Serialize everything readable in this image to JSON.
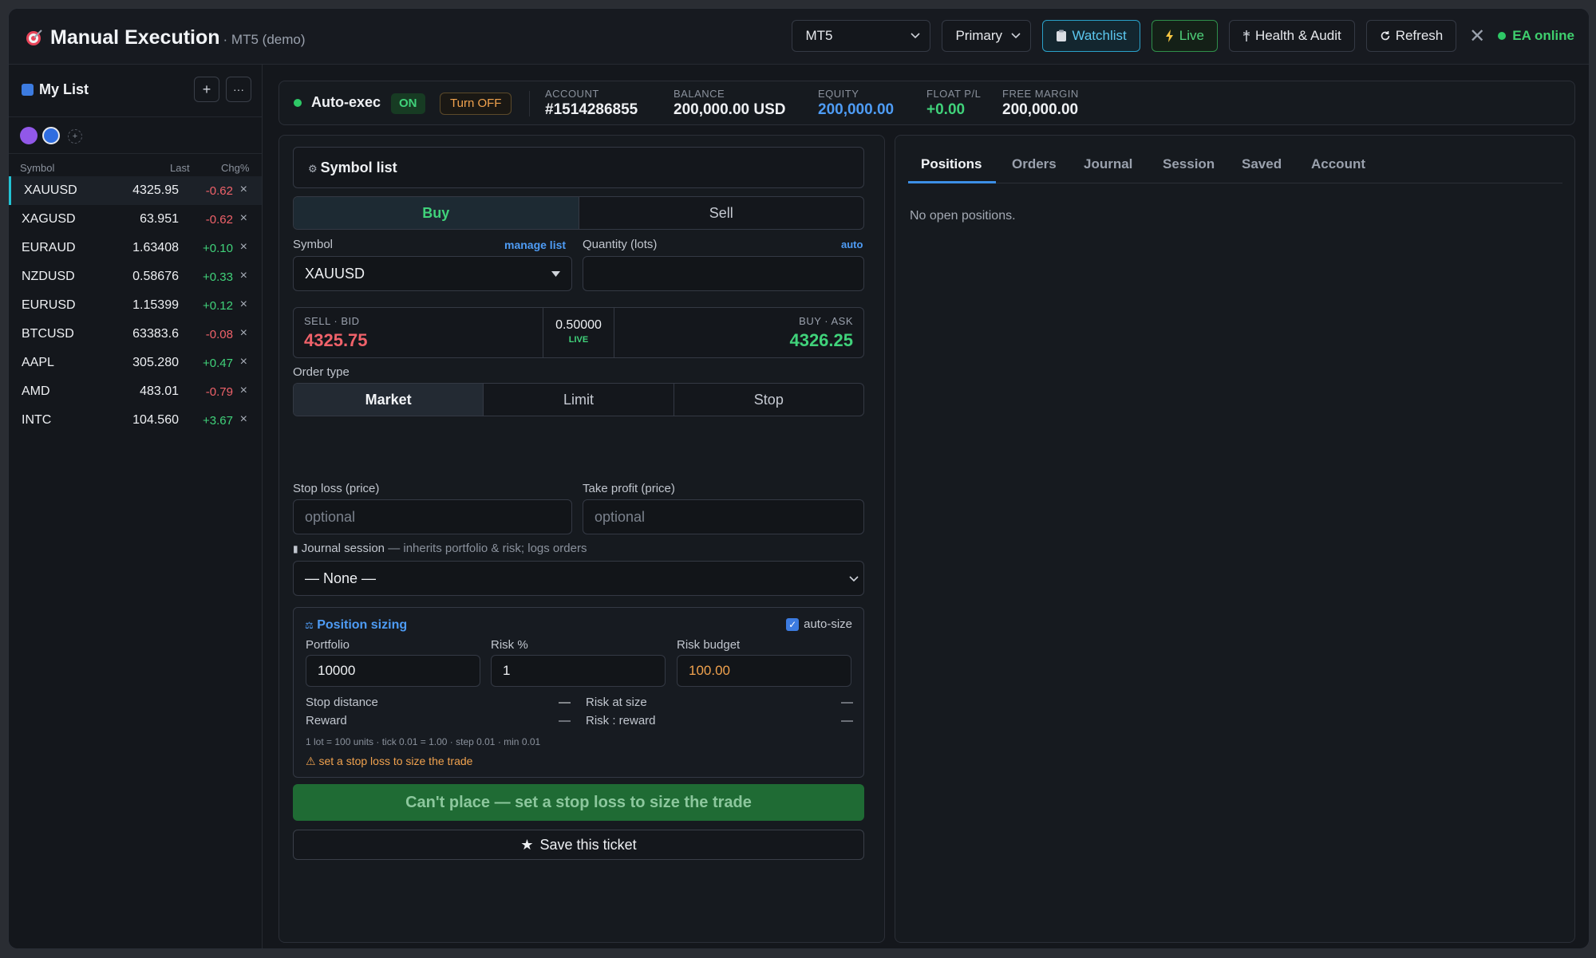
{
  "header": {
    "title": "Manual Execution",
    "subtitle": "· MT5 (demo)",
    "platform_select": "MT5",
    "account_select": "Primary",
    "watchlist_label": "Watchlist",
    "live_label": "Live",
    "health_label": "Health & Audit",
    "refresh_label": "Refresh",
    "close_glyph": "✕",
    "ea_status": "EA online"
  },
  "sidebar": {
    "list_name": "My List",
    "add_glyph": "+",
    "more_glyph": "···",
    "add_color_glyph": "+",
    "columns": {
      "symbol": "Symbol",
      "last": "Last",
      "chg": "Chg%"
    },
    "rows": [
      {
        "symbol": "XAUUSD",
        "last": "4325.95",
        "chg": "-0.62",
        "remove": "×"
      },
      {
        "symbol": "XAGUSD",
        "last": "63.951",
        "chg": "-0.62",
        "remove": "×"
      },
      {
        "symbol": "EURAUD",
        "last": "1.63408",
        "chg": "+0.10",
        "remove": "×"
      },
      {
        "symbol": "NZDUSD",
        "last": "0.58676",
        "chg": "+0.33",
        "remove": "×"
      },
      {
        "symbol": "EURUSD",
        "last": "1.15399",
        "chg": "+0.12",
        "remove": "×"
      },
      {
        "symbol": "BTCUSD",
        "last": "63383.6",
        "chg": "-0.08",
        "remove": "×"
      },
      {
        "symbol": "AAPL",
        "last": "305.280",
        "chg": "+0.47",
        "remove": "×"
      },
      {
        "symbol": "AMD",
        "last": "483.01",
        "chg": "-0.79",
        "remove": "×"
      },
      {
        "symbol": "INTC",
        "last": "104.560",
        "chg": "+3.67",
        "remove": "×"
      }
    ]
  },
  "status": {
    "auto_exec_label": "Auto-exec",
    "on_badge": "ON",
    "turn_off_label": "Turn OFF",
    "account_key": "ACCOUNT",
    "account_val": "#1514286855",
    "balance_key": "BALANCE",
    "balance_val": "200,000.00 USD",
    "equity_key": "EQUITY",
    "equity_val": "200,000.00",
    "float_key": "FLOAT P/L",
    "float_val": "+0.00",
    "free_key": "FREE MARGIN",
    "free_val": "200,000.00"
  },
  "ticket": {
    "symbol_list_label": "Symbol list",
    "buy_label": "Buy",
    "sell_label": "Sell",
    "symbol_label": "Symbol",
    "manage_list_link": "manage list",
    "symbol_value": "XAUUSD",
    "quantity_label": "Quantity (lots)",
    "auto_link": "auto",
    "sell_bid_key": "SELL · BID",
    "bid_value": "4325.75",
    "spread_value": "0.50000",
    "live_tag": "LIVE",
    "buy_ask_key": "BUY · ASK",
    "ask_value": "4326.25",
    "order_type_label": "Order type",
    "order_types": [
      "Market",
      "Limit",
      "Stop"
    ],
    "stop_loss_label": "Stop loss (price)",
    "stop_loss_placeholder": "optional",
    "take_profit_label": "Take profit (price)",
    "take_profit_placeholder": "optional",
    "journal_label": "Journal session",
    "journal_hint": "— inherits portfolio & risk; logs orders",
    "journal_value": "— None —",
    "sizing": {
      "title": "Position sizing",
      "auto_size_label": "auto-size",
      "portfolio_label": "Portfolio",
      "portfolio_value": "10000",
      "risk_label": "Risk %",
      "risk_value": "1",
      "budget_label": "Risk budget",
      "budget_value": "100.00",
      "stop_distance_label": "Stop distance",
      "stop_distance_value": "—",
      "risk_at_size_label": "Risk at size",
      "risk_at_size_value": "—",
      "reward_label": "Reward",
      "reward_value": "—",
      "rr_label": "Risk : reward",
      "rr_value": "—",
      "lot_info": "1 lot = 100 units · tick 0.01 = 1.00 · step 0.01 · min 0.01",
      "warning": "set a stop loss to size the trade"
    },
    "place_label": "Can't place — set a stop loss to size the trade",
    "save_label": "Save this ticket"
  },
  "right": {
    "tabs": [
      "Positions",
      "Orders",
      "Journal",
      "Session",
      "Saved",
      "Account"
    ],
    "empty_text": "No open positions."
  },
  "colors": {
    "accent_blue": "#4e9cf5",
    "positive": "#40d27a",
    "negative": "#f0626a",
    "warning": "#f0a24e"
  }
}
